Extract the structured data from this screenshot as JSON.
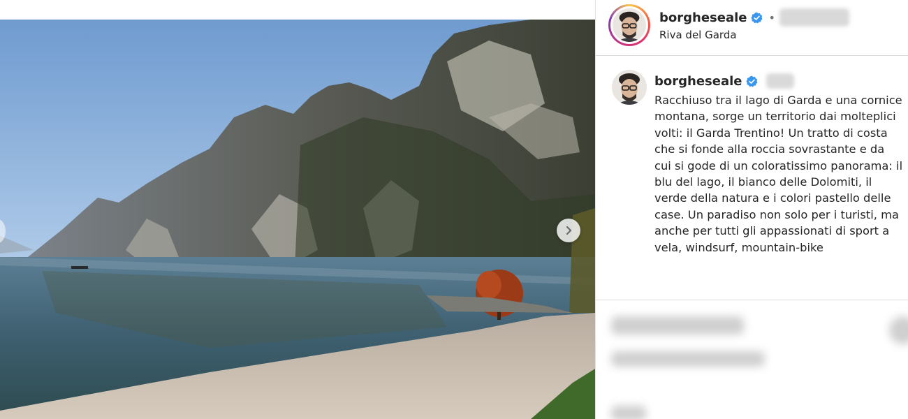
{
  "post": {
    "username": "borgheseale",
    "location": "Riva del Garda",
    "caption": "Racchiuso tra il lago di Garda e una cornice montana, sorge un territorio dai molteplici volti: il Garda Trentino! Un tratto di costa che si fonde alla roccia sovrastante e da cui si gode di un coloratissimo panorama: il blu del lago, il bianco delle Dolomiti, il verde della natura e i colori pastello delle case. Un paradiso non solo per i turisti, ma anche per tutti gli appassionati di sport a vela, windsurf, mountain-bike",
    "separator": "•"
  },
  "icons": {
    "verified": "verified-badge-icon",
    "next": "chevron-right-icon",
    "prev": "chevron-left-icon"
  },
  "colors": {
    "verified_blue": "#3897f0",
    "story_ring": [
      "#fdc84a",
      "#e1306c",
      "#833ab4"
    ]
  }
}
